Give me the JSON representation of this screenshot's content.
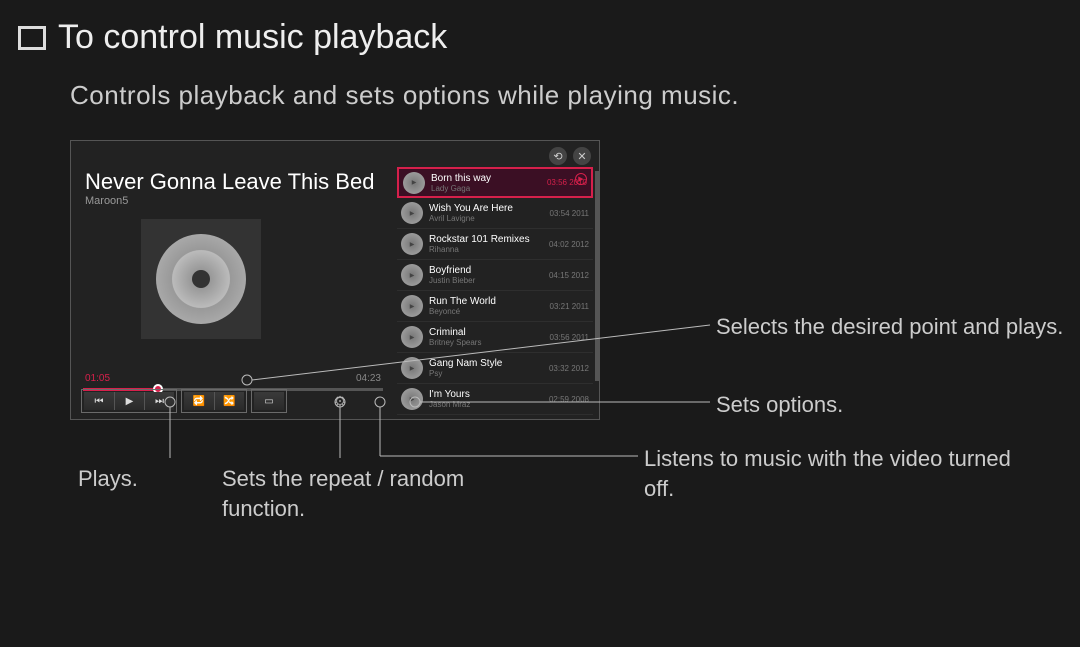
{
  "title": "To control music playback",
  "subtitle": "Controls playback and sets options while playing music.",
  "now_playing": {
    "title": "Never Gonna Leave This Bed",
    "artist": "Maroon5",
    "current_time": "01:05",
    "total_time": "04:23"
  },
  "playlist": [
    {
      "title": "Born this way",
      "artist": "Lady Gaga",
      "duration": "03:56",
      "year": "2010",
      "selected": true
    },
    {
      "title": "Wish You Are Here",
      "artist": "Avril Lavigne",
      "duration": "03:54",
      "year": "2011",
      "selected": false
    },
    {
      "title": "Rockstar 101 Remixes",
      "artist": "Rihanna",
      "duration": "04:02",
      "year": "2012",
      "selected": false
    },
    {
      "title": "Boyfriend",
      "artist": "Justin Bieber",
      "duration": "04:15",
      "year": "2012",
      "selected": false
    },
    {
      "title": "Run The World",
      "artist": "Beyoncé",
      "duration": "03:21",
      "year": "2011",
      "selected": false
    },
    {
      "title": "Criminal",
      "artist": "Britney Spears",
      "duration": "03:56",
      "year": "2011",
      "selected": false
    },
    {
      "title": "Gang Nam Style",
      "artist": "Psy",
      "duration": "03:32",
      "year": "2012",
      "selected": false
    },
    {
      "title": "I'm Yours",
      "artist": "Jason Mraz",
      "duration": "02:59",
      "year": "2008",
      "selected": false
    }
  ],
  "callouts": {
    "select_point": "Selects the desired point and plays.",
    "sets_options": "Sets options.",
    "video_off": "Listens to music with the video turned off.",
    "plays": "Plays.",
    "repeat_random": "Sets the repeat / random function."
  },
  "icons": {
    "back": "⟲",
    "close": "✕",
    "prev": "⏮",
    "play": "▶",
    "next": "⏭",
    "repeat": "🔁",
    "shuffle": "🔀",
    "display_off": "▭",
    "options": "⚙"
  }
}
